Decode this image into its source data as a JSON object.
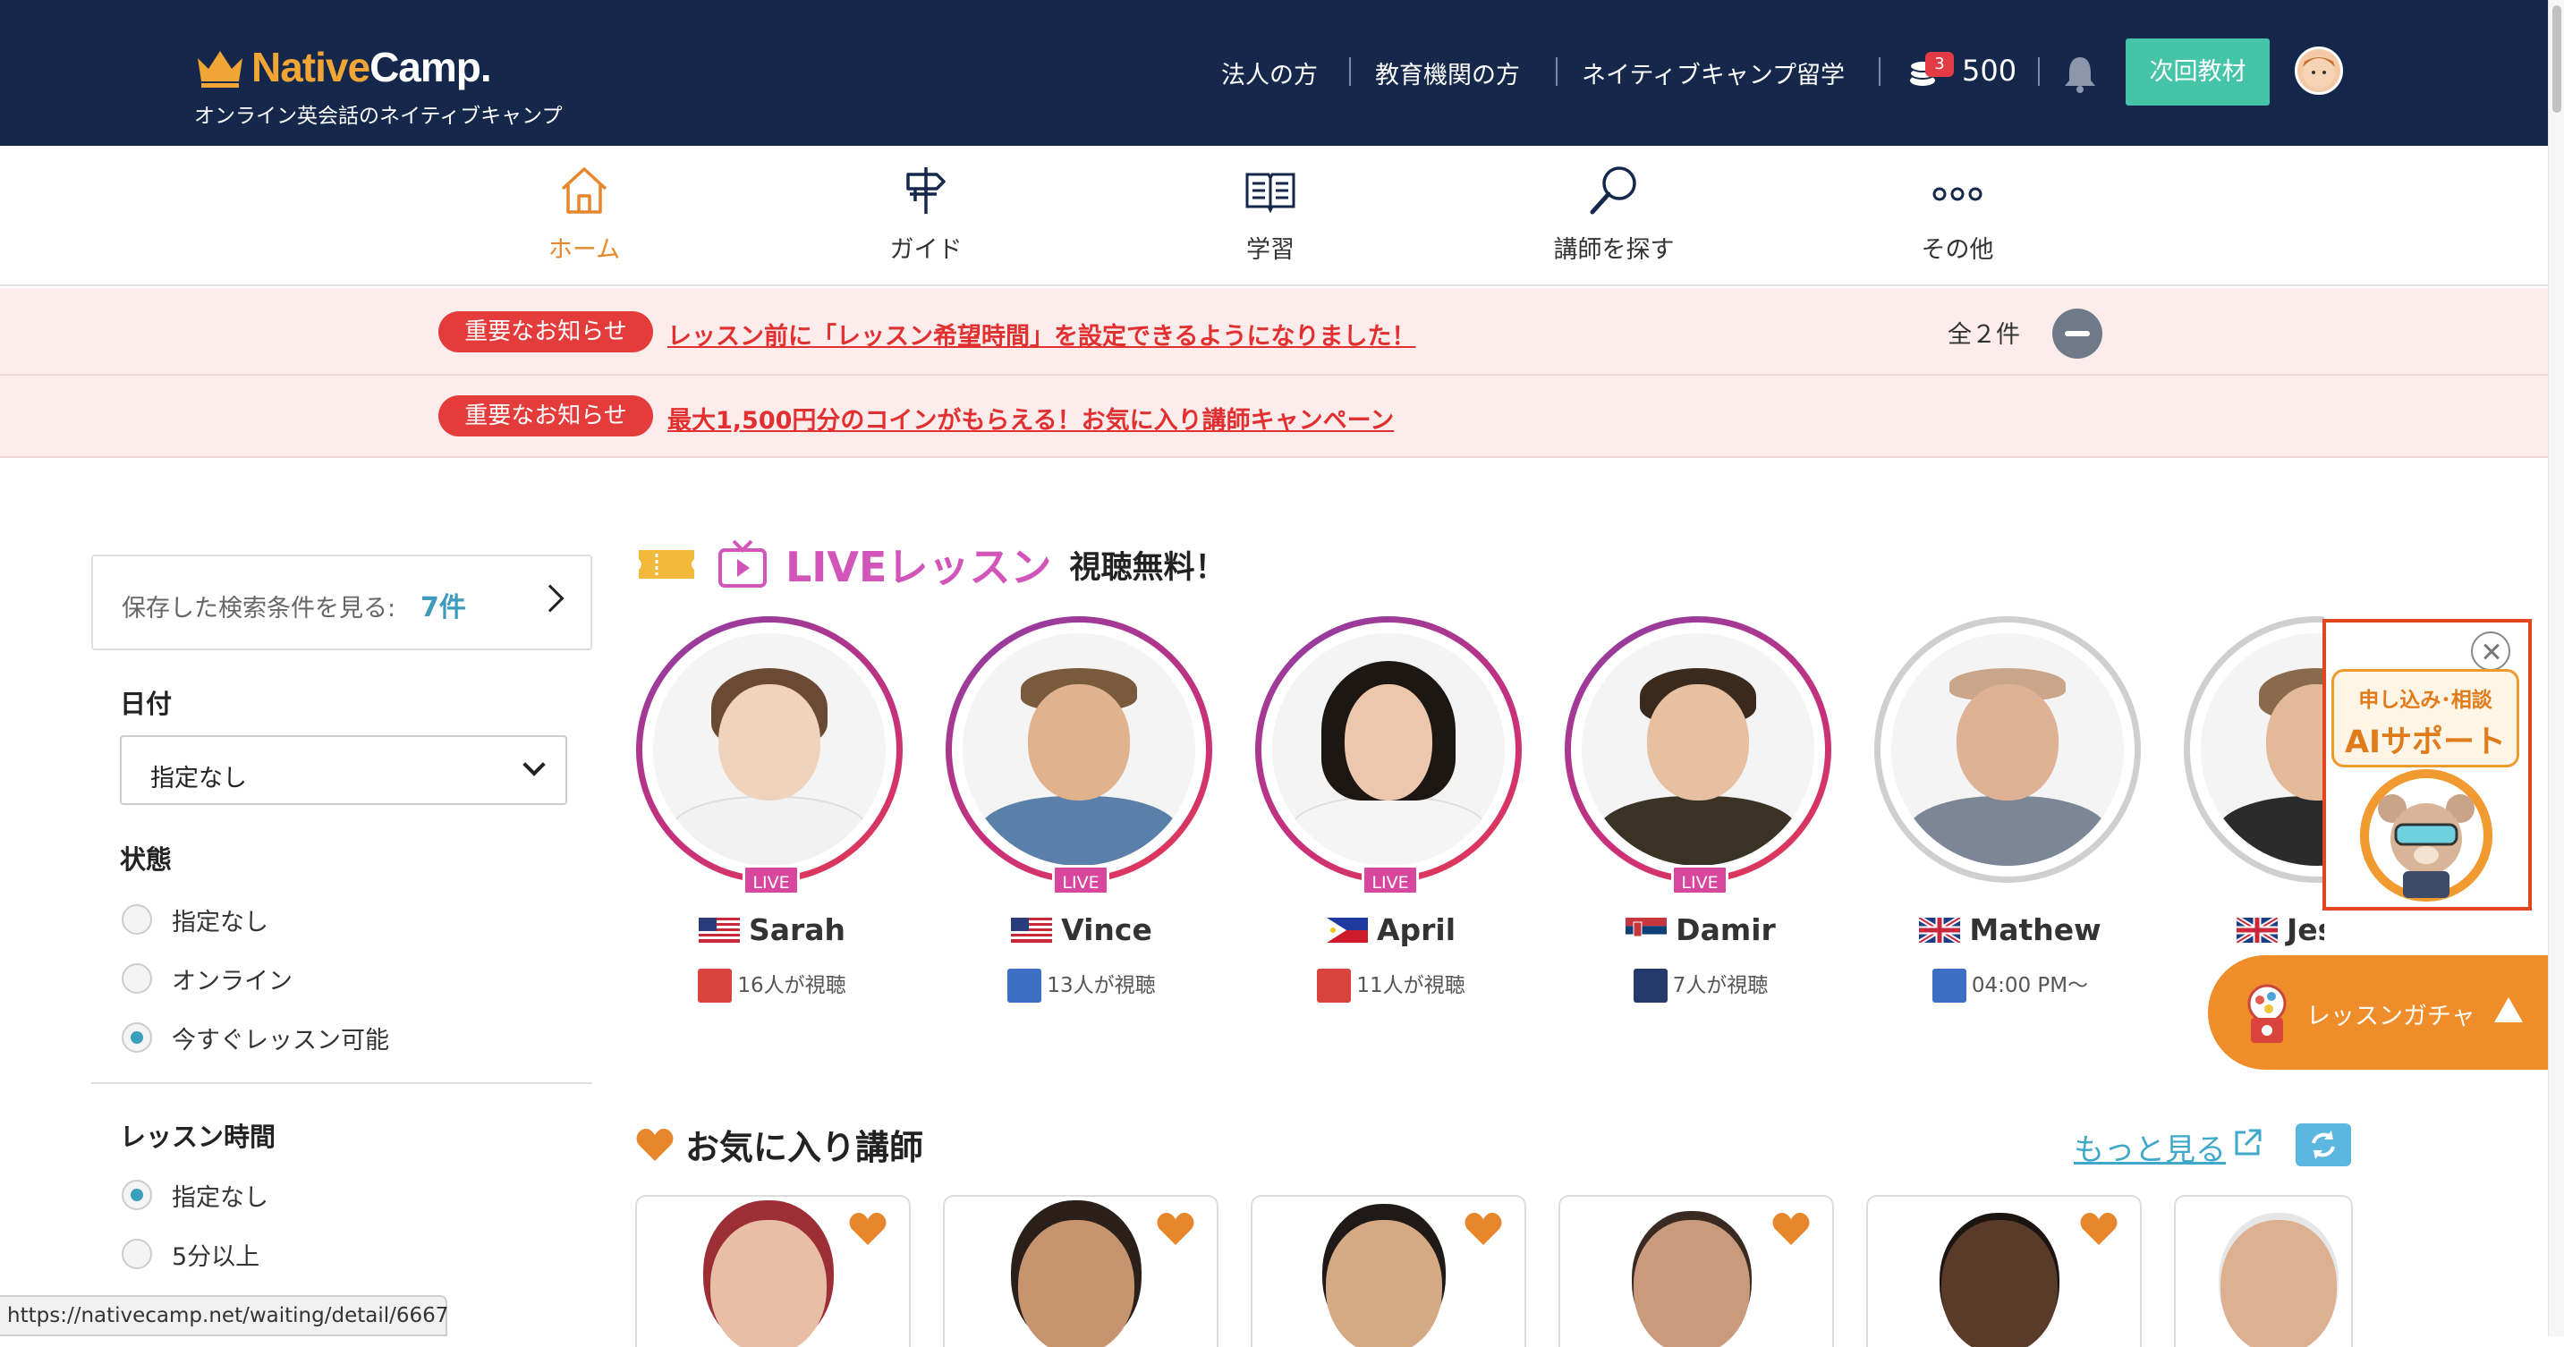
{
  "header": {
    "logo_native": "Native",
    "logo_camp": "Camp.",
    "logo_sub": "オンライン英会話のネイティブキャンプ",
    "links": [
      "法人の方",
      "教育機関の方",
      "ネイティブキャンプ留学"
    ],
    "coin_badge": "3",
    "coin_count": "500",
    "next_button": "次回教材"
  },
  "nav": {
    "items": [
      {
        "label": "ホーム",
        "icon": "home-icon"
      },
      {
        "label": "ガイド",
        "icon": "signpost-icon"
      },
      {
        "label": "学習",
        "icon": "book-icon"
      },
      {
        "label": "講師を探す",
        "icon": "search-icon"
      },
      {
        "label": "その他",
        "icon": "more-icon"
      }
    ]
  },
  "notices": {
    "tag": "重要なお知らせ",
    "items": [
      "レッスン前に「レッスン希望時間」を設定できるようになりました！",
      "最大1,500円分のコインがもらえる！お気に入り講師キャンペーン"
    ],
    "count": "全２件"
  },
  "sidebar": {
    "saved_label": "保存した検索条件を見る:",
    "saved_count": "7件",
    "date_title": "日付",
    "date_value": "指定なし",
    "status_title": "状態",
    "status_options": [
      "指定なし",
      "オンライン",
      "今すぐレッスン可能"
    ],
    "lesson_time_title": "レッスン時間",
    "lesson_time_options": [
      "指定なし",
      "5分以上"
    ]
  },
  "live": {
    "title": "LIVEレッスン",
    "subtitle": "視聴無料！",
    "badge": "LIVE",
    "teachers": [
      {
        "name": "Sarah",
        "flag": "us",
        "info": "16人が視聴",
        "live": true
      },
      {
        "name": "Vince",
        "flag": "us",
        "info": "13人が視聴",
        "live": true
      },
      {
        "name": "April",
        "flag": "ph",
        "info": "11人が視聴",
        "live": true
      },
      {
        "name": "Damir",
        "flag": "rs",
        "info": "7人が視聴",
        "live": true
      },
      {
        "name": "Mathew",
        "flag": "gb",
        "info": "04:00 PM〜",
        "live": false
      },
      {
        "name": "Jess",
        "flag": "gb",
        "info": "",
        "live": false
      }
    ]
  },
  "ai_support": {
    "line1": "申し込み･相談",
    "line2": "AIサポート"
  },
  "gacha": {
    "label": "レッスンガチャ"
  },
  "favorites": {
    "title": "お気に入り講師",
    "more": "もっと見る"
  },
  "status_url": "https://nativecamp.net/waiting/detail/6667",
  "colors": {
    "header_bg": "#15284b",
    "accent_orange": "#e8862c",
    "live_pink": "#d256b9",
    "notice_red": "#e43b3b",
    "teal": "#45c4a7"
  }
}
